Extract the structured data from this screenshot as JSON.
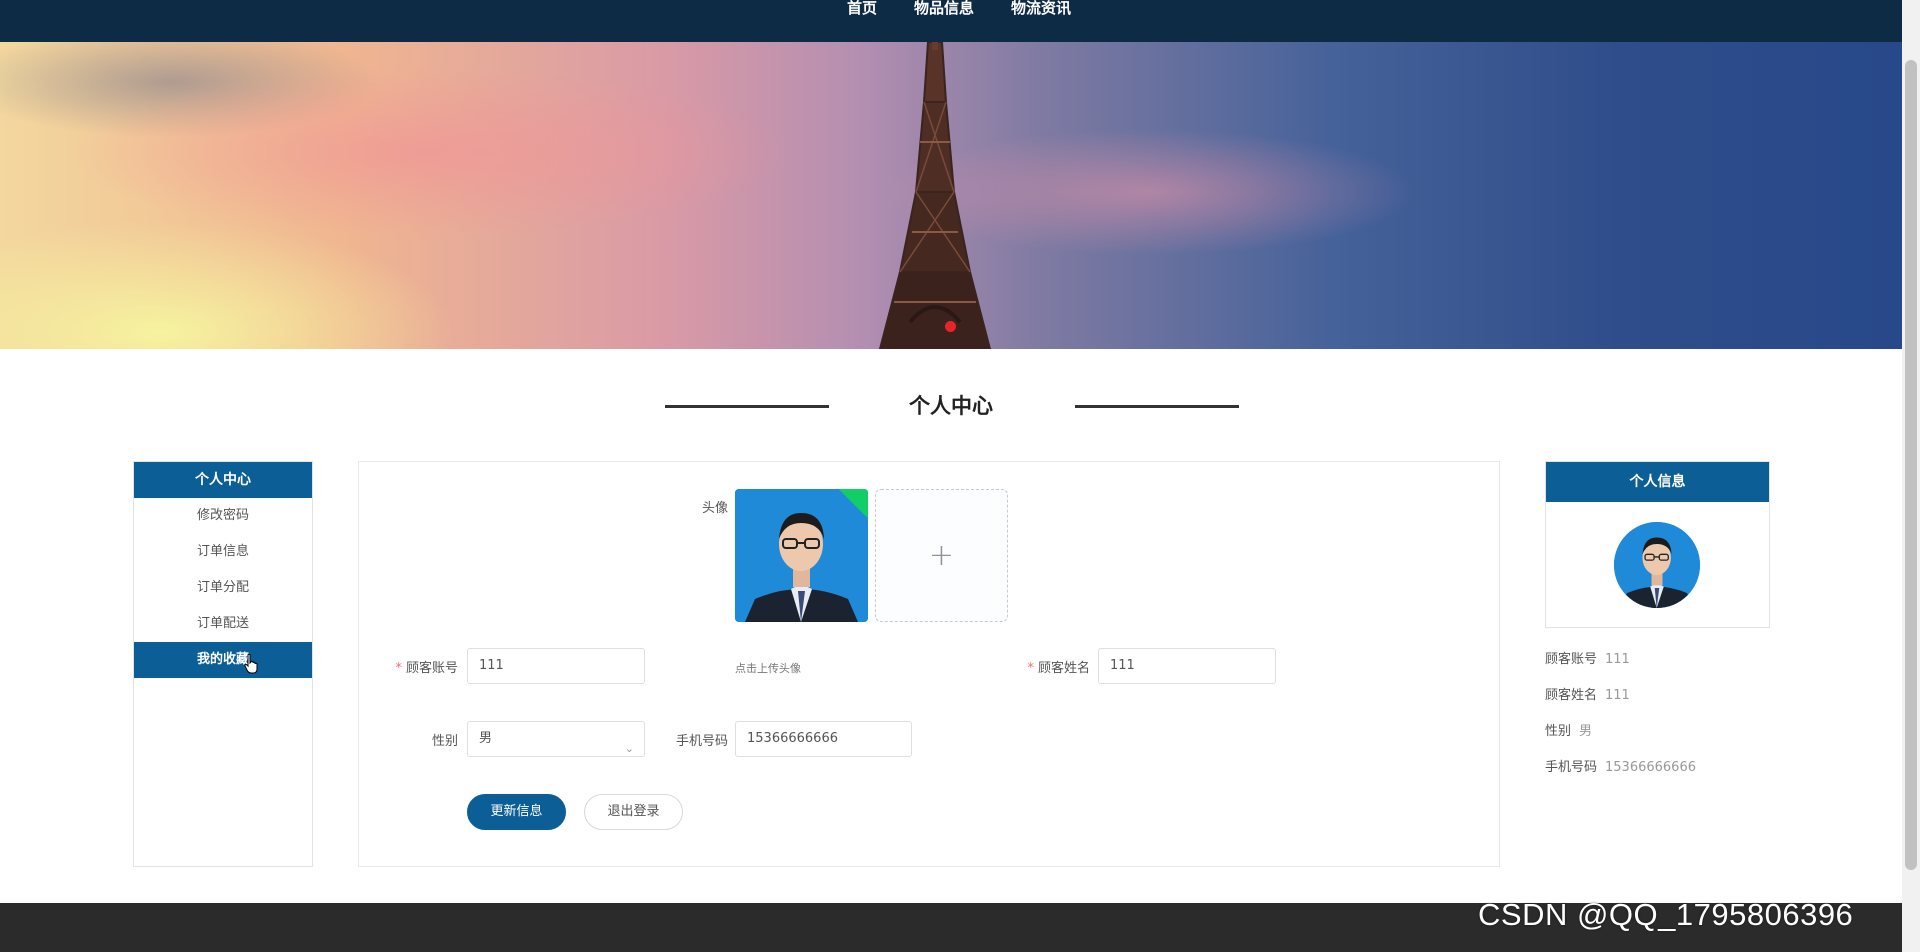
{
  "nav": {
    "items": [
      {
        "label": "首页"
      },
      {
        "label": "物品信息"
      },
      {
        "label": "物流资讯"
      }
    ]
  },
  "page": {
    "title": "个人中心"
  },
  "sidebar": {
    "header": "个人中心",
    "items": [
      {
        "label": "修改密码"
      },
      {
        "label": "订单信息"
      },
      {
        "label": "订单分配"
      },
      {
        "label": "订单配送"
      },
      {
        "label": "我的收藏",
        "active": true
      }
    ]
  },
  "form": {
    "avatar_label": "头像",
    "upload_hint": "点击上传头像",
    "account_label": "顾客账号",
    "account_value": "111",
    "name_label": "顾客姓名",
    "name_value": "111",
    "gender_label": "性别",
    "gender_value": "男",
    "phone_label": "手机号码",
    "phone_value": "15366666666",
    "update_button": "更新信息",
    "logout_button": "退出登录"
  },
  "info_panel": {
    "header": "个人信息",
    "rows": [
      {
        "key": "顾客账号",
        "value": "111"
      },
      {
        "key": "顾客姓名",
        "value": "111"
      },
      {
        "key": "性别",
        "value": "男"
      },
      {
        "key": "手机号码",
        "value": "15366666666"
      }
    ]
  },
  "watermark": "CSDN @QQ_1795806396",
  "colors": {
    "primary": "#0c5f96",
    "nav_bg": "#0d2b45",
    "footer_bg": "#2b2b2b",
    "required": "#f56c6c",
    "upload_success": "#13ce66"
  }
}
